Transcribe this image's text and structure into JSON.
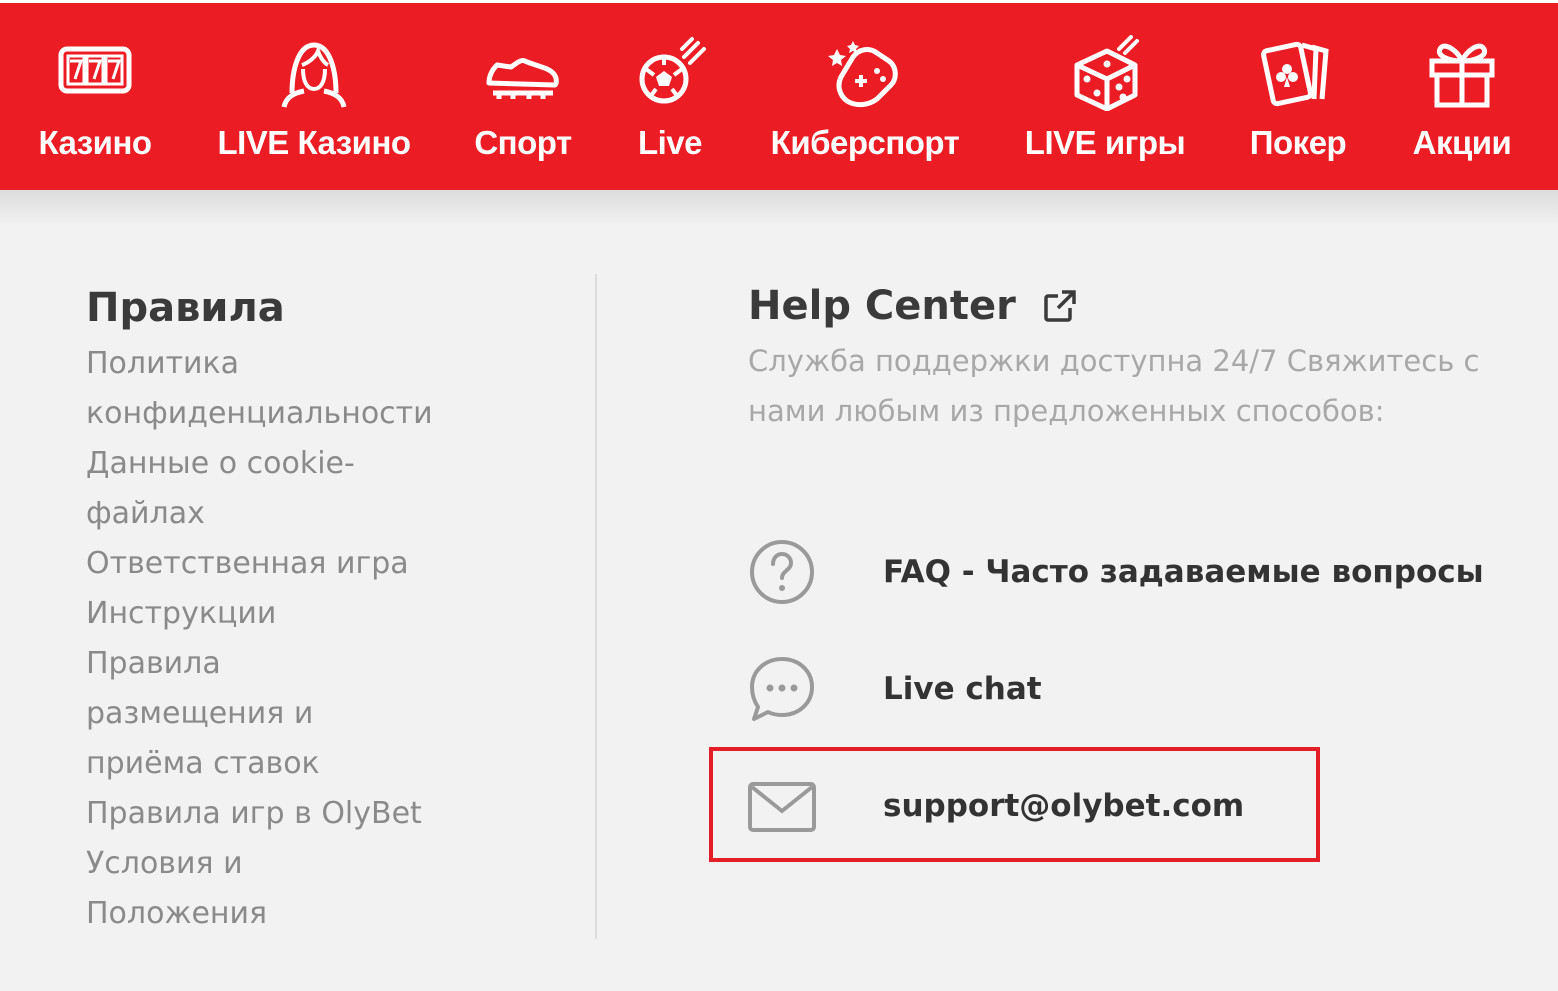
{
  "nav": {
    "items": [
      {
        "label": "Казино",
        "icon": "slot-machine-777-icon"
      },
      {
        "label": "LIVE Казино",
        "icon": "live-dealer-woman-icon"
      },
      {
        "label": "Спорт",
        "icon": "football-boot-icon"
      },
      {
        "label": "Live",
        "icon": "flying-soccer-ball-icon"
      },
      {
        "label": "Киберспорт",
        "icon": "gamepad-icon"
      },
      {
        "label": "LIVE игры",
        "icon": "dice-icon"
      },
      {
        "label": "Покер",
        "icon": "playing-cards-icon"
      },
      {
        "label": "Акции",
        "icon": "gift-icon"
      }
    ]
  },
  "rules": {
    "title": "Правила",
    "links": [
      "Политика конфиденциальности",
      "Данные о cookie-файлах",
      "Ответственная игра",
      "Инструкции",
      "Правила размещения и приёма ставок",
      "Правила игр в OlyBet",
      "Условия и Положения"
    ]
  },
  "help": {
    "title": "Help Center",
    "title_icon": "external-link-icon",
    "description": "Служба поддержки доступна 24/7 Свяжитесь с нами любым из предложенных способов:",
    "contacts": [
      {
        "label": "FAQ - Часто задаваемые вопросы",
        "icon": "question-circle-icon"
      },
      {
        "label": "Live chat",
        "icon": "chat-bubble-icon"
      },
      {
        "label": "support@olybet.com",
        "icon": "envelope-icon"
      }
    ]
  },
  "colors": {
    "brand_red": "#ec1c24",
    "highlight_border": "#e31e26"
  }
}
